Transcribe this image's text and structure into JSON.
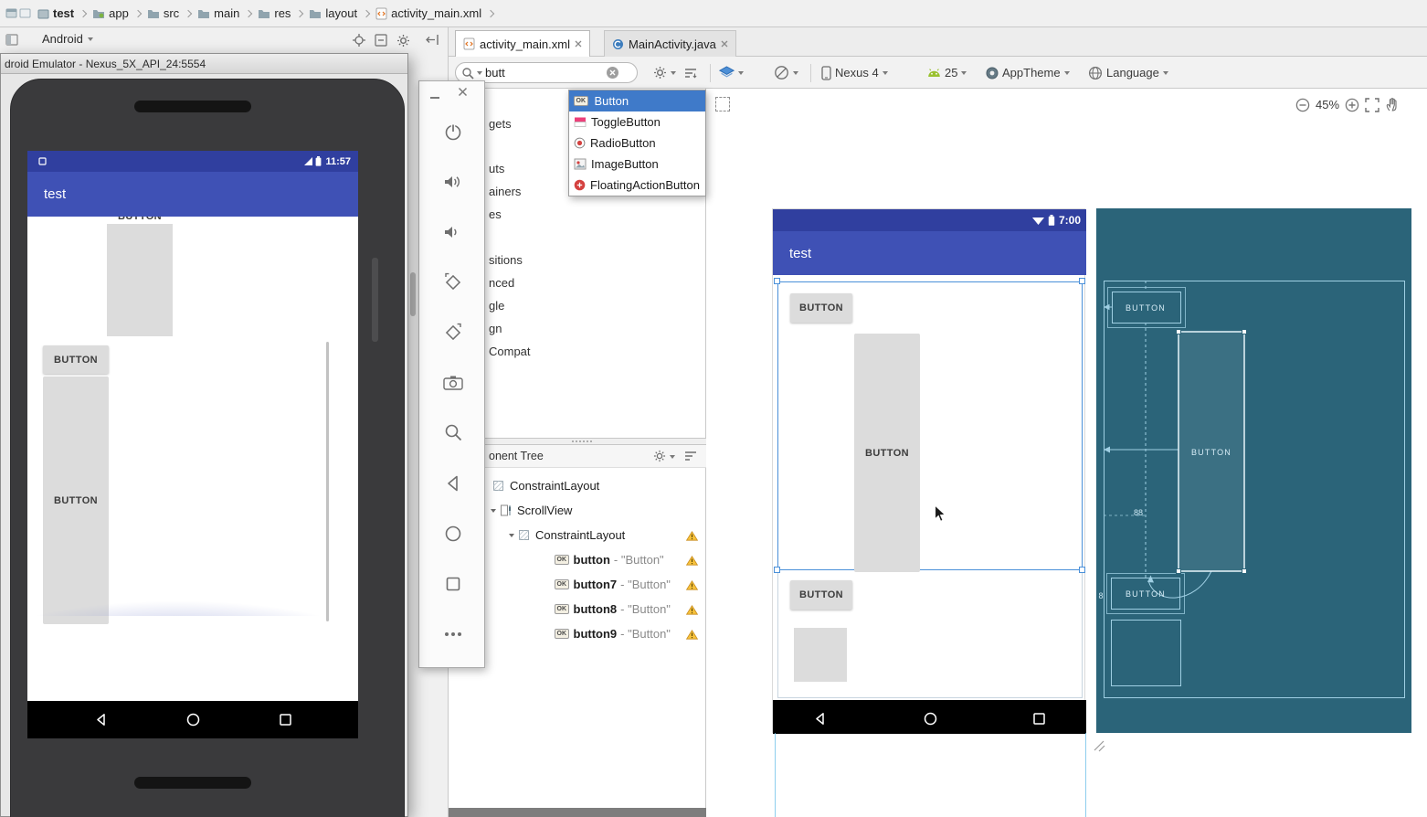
{
  "breadcrumb": {
    "items": [
      "test",
      "app",
      "src",
      "main",
      "res",
      "layout",
      "activity_main.xml"
    ]
  },
  "project_panel": {
    "title": "Android"
  },
  "emulator": {
    "window_title": "droid Emulator - Nexus_5X_API_24:5554",
    "status_time": "11:57",
    "app_title": "test",
    "clipped_button_label": "BUTTON",
    "button_label": "BUTTON",
    "tall_button_label": "BUTTON"
  },
  "editor_tabs": {
    "tab1": "activity_main.xml",
    "tab2": "MainActivity.java"
  },
  "toolbar": {
    "search_value": "butt",
    "device_label": "Nexus 4",
    "api_level": "25",
    "theme_label": "AppTheme",
    "language_label": "Language"
  },
  "zoom_controls": {
    "zoom_level": "45%"
  },
  "palette": {
    "results": [
      {
        "badge": "OK",
        "label": "Button"
      },
      {
        "label": "ToggleButton"
      },
      {
        "label": "RadioButton"
      },
      {
        "label": "ImageButton"
      },
      {
        "label": "FloatingActionButton"
      }
    ],
    "category_fragments": [
      "gets",
      "uts",
      "ainers",
      "es",
      "sitions",
      "nced",
      "gle",
      "gn",
      "Compat"
    ]
  },
  "component_tree": {
    "title": "onent Tree",
    "nodes": [
      {
        "label": "ConstraintLayout"
      },
      {
        "label": "ScrollView"
      },
      {
        "label": "ConstraintLayout"
      },
      {
        "badge": "OK",
        "name": "button",
        "value": "- \"Button\""
      },
      {
        "badge": "OK",
        "name": "button7",
        "value": "- \"Button\""
      },
      {
        "badge": "OK",
        "name": "button8",
        "value": "- \"Button\""
      },
      {
        "badge": "OK",
        "name": "button9",
        "value": "- \"Button\""
      }
    ]
  },
  "design_view": {
    "status_time": "7:00",
    "app_title": "test",
    "button1_label": "BUTTON",
    "big_button_label": "BUTTON",
    "button3_label": "BUTTON"
  },
  "blueprint_view": {
    "button1_label": "BUTTON",
    "big_button_label": "BUTTON",
    "button3_label": "BUTTON",
    "margin_88": "88",
    "margin_8": "8"
  },
  "colors": {
    "app_primary": "#3f51b5",
    "app_primary_dark": "#303f9f",
    "blueprint_bg": "#2b6479",
    "selection_blue": "#4a90d9"
  }
}
